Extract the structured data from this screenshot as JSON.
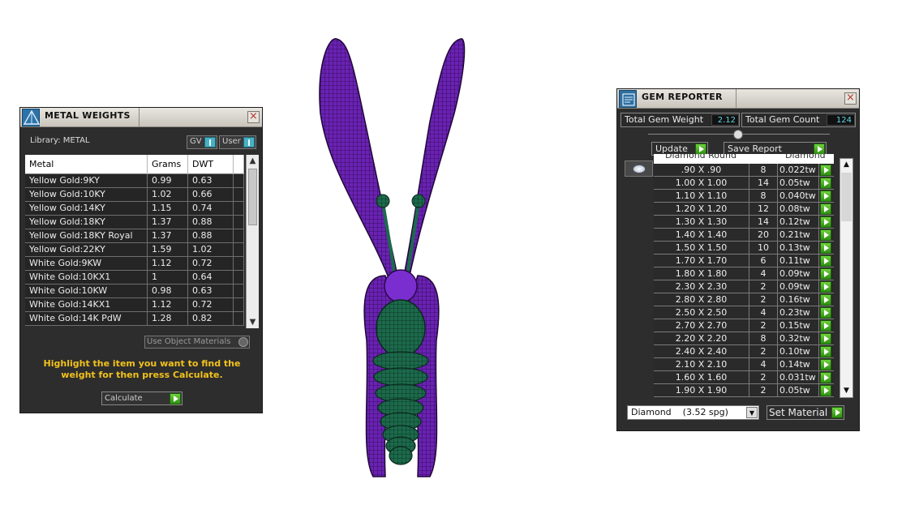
{
  "metal_weights": {
    "title": "METAL WEIGHTS",
    "library_label": "Library: METAL",
    "toggle_gv": "GV",
    "toggle_user": "User",
    "columns": [
      "Metal",
      "Grams",
      "DWT"
    ],
    "rows": [
      {
        "metal": "Yellow Gold:9KY",
        "grams": "0.99",
        "dwt": "0.63"
      },
      {
        "metal": "Yellow Gold:10KY",
        "grams": "1.02",
        "dwt": "0.66"
      },
      {
        "metal": "Yellow Gold:14KY",
        "grams": "1.15",
        "dwt": "0.74"
      },
      {
        "metal": "Yellow Gold:18KY",
        "grams": "1.37",
        "dwt": "0.88"
      },
      {
        "metal": "Yellow Gold:18KY Royal",
        "grams": "1.37",
        "dwt": "0.88"
      },
      {
        "metal": "Yellow Gold:22KY",
        "grams": "1.59",
        "dwt": "1.02"
      },
      {
        "metal": "White Gold:9KW",
        "grams": "1.12",
        "dwt": "0.72"
      },
      {
        "metal": "White Gold:10KX1",
        "grams": "1",
        "dwt": "0.64"
      },
      {
        "metal": "White Gold:10KW",
        "grams": "0.98",
        "dwt": "0.63"
      },
      {
        "metal": "White Gold:14KX1",
        "grams": "1.12",
        "dwt": "0.72"
      },
      {
        "metal": "White Gold:14K PdW",
        "grams": "1.28",
        "dwt": "0.82"
      }
    ],
    "use_object_materials": "Use Object Materials",
    "instructions": "Highlight the item you want to find the weight for then press Calculate.",
    "calculate_label": "Calculate"
  },
  "gem_reporter": {
    "title": "GEM REPORTER",
    "total_weight_label": "Total Gem Weight",
    "total_weight_value": "2.12",
    "total_count_label": "Total Gem Count",
    "total_count_value": "124",
    "update_label": "Update",
    "save_report_label": "Save Report",
    "columns": [
      "Diamond Round",
      "Diamond"
    ],
    "rows": [
      {
        "size": ".90 X .90",
        "count": "8",
        "weight": "0.022tw"
      },
      {
        "size": "1.00 X 1.00",
        "count": "14",
        "weight": "0.05tw"
      },
      {
        "size": "1.10 X 1.10",
        "count": "8",
        "weight": "0.040tw"
      },
      {
        "size": "1.20 X 1.20",
        "count": "12",
        "weight": "0.08tw"
      },
      {
        "size": "1.30 X 1.30",
        "count": "14",
        "weight": "0.12tw"
      },
      {
        "size": "1.40 X 1.40",
        "count": "20",
        "weight": "0.21tw"
      },
      {
        "size": "1.50 X 1.50",
        "count": "10",
        "weight": "0.13tw"
      },
      {
        "size": "1.70 X 1.70",
        "count": "6",
        "weight": "0.11tw"
      },
      {
        "size": "1.80 X 1.80",
        "count": "4",
        "weight": "0.09tw"
      },
      {
        "size": "2.30 X 2.30",
        "count": "2",
        "weight": "0.09tw"
      },
      {
        "size": "2.80 X 2.80",
        "count": "2",
        "weight": "0.16tw"
      },
      {
        "size": "2.50 X 2.50",
        "count": "4",
        "weight": "0.23tw"
      },
      {
        "size": "2.70 X 2.70",
        "count": "2",
        "weight": "0.15tw"
      },
      {
        "size": "2.20 X 2.20",
        "count": "8",
        "weight": "0.32tw"
      },
      {
        "size": "2.40 X 2.40",
        "count": "2",
        "weight": "0.10tw"
      },
      {
        "size": "2.10 X 2.10",
        "count": "4",
        "weight": "0.14tw"
      },
      {
        "size": "1.60 X 1.60",
        "count": "2",
        "weight": "0.031tw"
      },
      {
        "size": "1.90 X 1.90",
        "count": "2",
        "weight": "0.05tw"
      }
    ],
    "material_select": "Diamond    (3.52 spg)",
    "set_material_label": "Set Material"
  },
  "colors": {
    "panel_bg": "#2d2d2d",
    "accent_green": "#3aa617",
    "highlight_yellow": "#f2c21b",
    "value_cyan": "#5fd6e6",
    "model_purple": "#6a22b3",
    "model_green": "#1c6a4c"
  },
  "icons": {
    "metal_title_icon": "pyramid-icon",
    "gem_title_icon": "report-icon",
    "close": "close-icon",
    "arrow": "play-arrow-icon"
  }
}
